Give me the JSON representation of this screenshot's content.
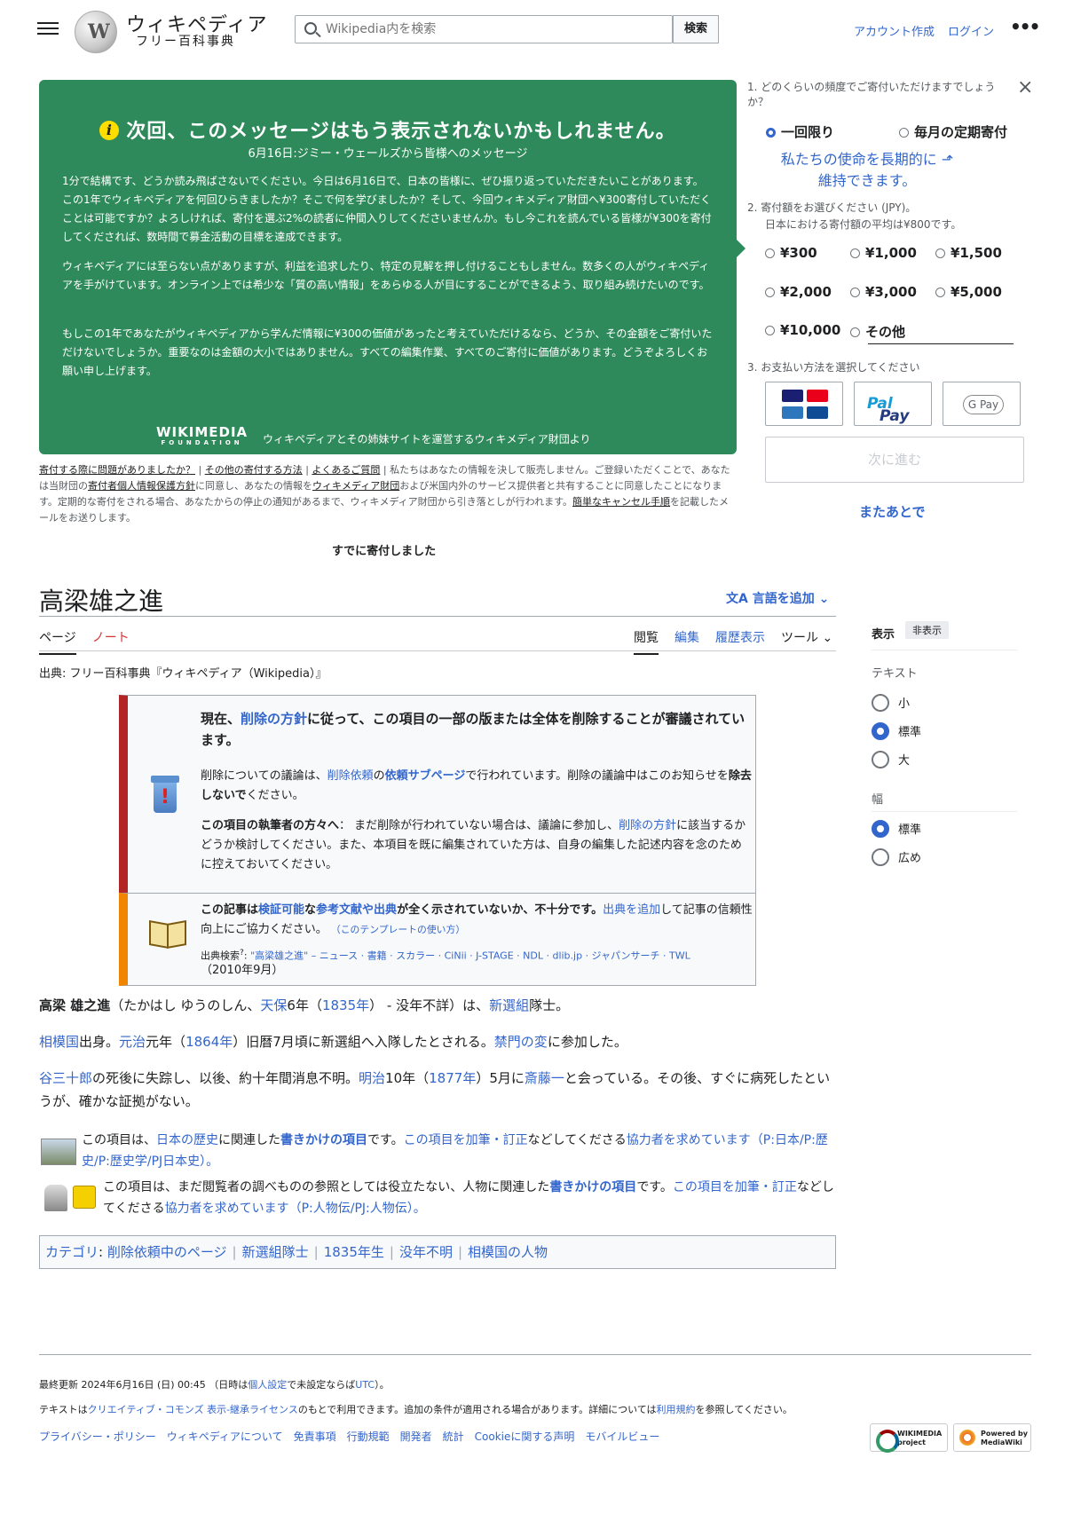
{
  "header": {
    "logo_title": "ウィキペディア",
    "logo_tagline": "フリー百科事典",
    "search_placeholder": "Wikipedia内を検索",
    "search_button": "検索",
    "create_account": "アカウント作成",
    "login": "ログイン",
    "more": "•••"
  },
  "banner": {
    "heading": "次回、このメッセージはもう表示されないかもしれません。",
    "subheading": "6月16日:ジミー・ウェールズから皆様へのメッセージ",
    "para1": "1分で結構です、どうか読み飛ばさないでください。今日は6月16日で、日本の皆様に、ぜひ振り返っていただきたいことがあります。この1年でウィキペディアを何回ひらきましたか？そこで何を学びましたか？そして、今回ウィキメディア財団へ¥300寄付していただくことは可能ですか？よろしければ、寄付を選ぶ2%の読者に仲間入りしてくださいませんか。もし今これを読んでいる皆様が¥300を寄付してくだされば、数時間で募金活動の目標を達成できます。",
    "para2": "ウィキペディアには至らない点がありますが、利益を追求したり、特定の見解を押し付けることもしません。数多くの人がウィキペディアを手がけています。オンライン上では希少な「質の高い情報」をあらゆる人が目にすることができるよう、取り組み続けたいのです。",
    "para3": "もしこの1年であなたがウィキペディアから学んだ情報に¥300の価値があったと考えていただけるなら、どうか、その金額をご寄付いただけないでしょうか。重要なのは金額の大小ではありません。すべての編集作業、すべてのご寄付に価値があります。どうぞよろしくお願い申し上げます。",
    "logo_main": "WIKIMEDIA",
    "logo_sub": "FOUNDATION",
    "from": "ウィキペディアとその姉妹サイトを運営するウィキメディア財団より"
  },
  "banner_footer": {
    "link_problem": "寄付する際に問題がありましたか？",
    "link_other": "その他の寄付する方法",
    "link_faq": "よくあるご質問",
    "text1": "私たちはあなたの情報を決して販売しません。ご登録いただくことで、あなたは当財団の",
    "link_policy": "寄付者個人情報保護方針",
    "text2": "に同意し、あなたの情報を",
    "link_foundation": "ウィキメディア財団",
    "text3": "および米国内外のサービス提供者と共有することに同意したことになります。定期的な寄付をされる場合、あなたからの停止の通知があるまで、ウィキメディア財団から引き落としが行われます。",
    "link_cancel": "簡単なキャンセル手順",
    "text4": "を記載したメールをお送りします。",
    "already_donated": "すでに寄付しました"
  },
  "donate_form": {
    "q1": "1. どのくらいの頻度でご寄付いただけますでしょうか？",
    "close": "×",
    "once": "一回限り",
    "monthly": "毎月の定期寄付",
    "pitch_line1": "私たちの使命を長期的に",
    "pitch_line2": "維持できます。",
    "q2": "2. 寄付額をお選びください (JPY)。",
    "q2_note": "日本における寄付額の平均は¥800です。",
    "amounts": [
      "¥300",
      "¥1,000",
      "¥1,500",
      "¥2,000",
      "¥3,000",
      "¥5,000",
      "¥10,000",
      "その他"
    ],
    "q3": "3. お支払い方法を選択してください",
    "paypal": "Pay",
    "paypal_b": "Pal",
    "gpay": "G Pay",
    "next": "次に進む",
    "later": "またあとで"
  },
  "article": {
    "title": "高梁雄之進",
    "add_language": "言語を追加",
    "tab_page": "ページ",
    "tab_talk": "ノート",
    "tab_read": "閲覧",
    "tab_edit": "編集",
    "tab_history": "履歴表示",
    "tab_tools": "ツール",
    "from_line": "出典: フリー百科事典『ウィキペディア（Wikipedia）』"
  },
  "ambox1": {
    "t1a": "現在、",
    "t1link": "削除の方針",
    "t1b": "に従って、この項目の一部の版または全体を削除することが審議されています。",
    "t2a": "削除についての議論は、",
    "t2link1": "削除依頼",
    "t2b": "の",
    "t2link2": "依頼サブページ",
    "t2c": "で行われています。削除の議論中はこのお知らせを",
    "t2bold": "除去しないで",
    "t2d": "ください。",
    "t3bold": "この項目の執筆者の方々へ",
    "t3a": "： まだ削除が行われていない場合は、議論に参加し、",
    "t3link": "削除の方針",
    "t3b": "に該当するかどうか検討してください。また、本項目を既に編集されていた方は、自身の編集した記述内容を念のために控えておいてください。"
  },
  "ambox2": {
    "a": "この記事は",
    "link1": "検証可能",
    "b": "な",
    "link2": "参考文献や出典",
    "c": "が全く示されていないか、不十分です。",
    "link3": "出典を追加",
    "d": "して記事の信頼性向上にご協力ください。",
    "template_usage": "（このテンプレートの使い方）",
    "search_label": "出典検索",
    "search_links": "\"高梁雄之進\" – ニュース · 書籍 · スカラー · CiNii · J-STAGE · NDL · dlib.jp · ジャパンサーチ · TWL",
    "date": "（2010年9月）"
  },
  "body": {
    "p1_bold": "高梁 雄之進",
    "p1_a": "（たかはし ゆうのしん、",
    "p1_l1": "天保",
    "p1_b": "6年（",
    "p1_l2": "1835年",
    "p1_c": "） - 没年不詳）は、",
    "p1_l3": "新選組",
    "p1_d": "隊士。",
    "p2_l1": "相模国",
    "p2_a": "出身。",
    "p2_l2": "元治",
    "p2_b": "元年（",
    "p2_l3": "1864年",
    "p2_c": "）旧暦7月頃に新選組へ入隊したとされる。",
    "p2_l4": "禁門の変",
    "p2_d": "に参加した。",
    "p3_l1": "谷三十郎",
    "p3_a": "の死後に失踪し、以後、約十年間消息不明。",
    "p3_l2": "明治",
    "p3_b": "10年（",
    "p3_l3": "1877年",
    "p3_c": "）5月に",
    "p3_l4": "斎藤一",
    "p3_d": "と会っている。その後、すぐに病死したというが、確かな証拠がない。"
  },
  "stubs": {
    "s1_a": "この項目は、",
    "s1_l1": "日本の歴史",
    "s1_b": "に関連した",
    "s1_l2": "書きかけの項目",
    "s1_c": "です。",
    "s1_l3": "この項目を加筆・訂正",
    "s1_d": "などしてくださる",
    "s1_l4": "協力者を求めています",
    "s1_e": "（P:日本/P:歴史/P:歴史学/PJ日本史）。",
    "s2_a": "この項目は、まだ閲覧者の調べものの参照としては役立たない、人物に関連した",
    "s2_l1": "書きかけの項目",
    "s2_b": "です。",
    "s2_l2": "この項目を加筆・訂正",
    "s2_c": "などしてくださる",
    "s2_l3": "協力者を求めています",
    "s2_d": "（P:人物伝/PJ:人物伝）。"
  },
  "categories": {
    "label": "カテゴリ",
    "items": [
      "削除依頼中のページ",
      "新選組隊士",
      "1835年生",
      "没年不明",
      "相模国の人物"
    ]
  },
  "sidebar": {
    "appearance": "表示",
    "hide": "非表示",
    "text_label": "テキスト",
    "text_small": "小",
    "text_standard": "標準",
    "text_large": "大",
    "width_label": "幅",
    "width_standard": "標準",
    "width_wide": "広め"
  },
  "footer": {
    "last_edit_a": "最終更新 2024年6月16日 (日) 00:45 （日時は",
    "last_edit_link": "個人設定",
    "last_edit_b": "で未設定ならば",
    "last_edit_utc": "UTC",
    "last_edit_c": "）。",
    "license_a": "テキストは",
    "license_link": "クリエイティブ・コモンズ 表示-継承ライセンス",
    "license_b": "のもとで利用できます。追加の条件が適用される場合があります。詳細については",
    "license_terms": "利用規約",
    "license_c": "を参照してください。",
    "links": [
      "プライバシー・ポリシー",
      "ウィキペディアについて",
      "免責事項",
      "行動規範",
      "開発者",
      "統計",
      "Cookieに関する声明",
      "モバイルビュー"
    ],
    "badge_wm": "WIKIMEDIA project",
    "badge_mw": "Powered by MediaWiki"
  }
}
